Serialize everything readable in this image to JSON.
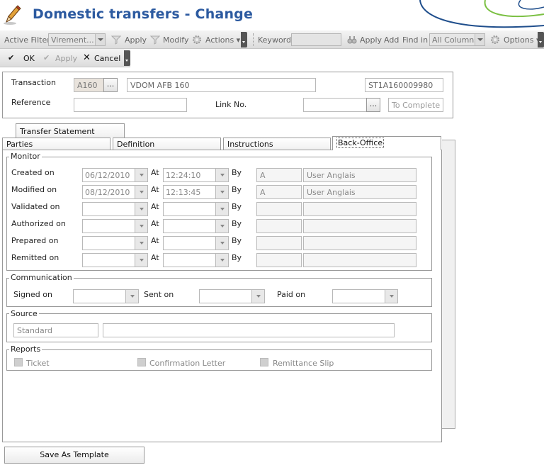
{
  "window": {
    "title": "Domestic transfers - Change"
  },
  "toolbar": {
    "active_filter_label": "Active Filter",
    "filter_value": "Virement...",
    "apply_label": "Apply",
    "modify_label": "Modify",
    "actions_label": "Actions",
    "keyword_label": "Keyword",
    "keyword_value": "",
    "apply2_label": "Apply",
    "add_label": "Add",
    "find_in_label": "Find in",
    "find_in_value": "All Columns",
    "options_label": "Options"
  },
  "toolbar2": {
    "ok_label": "OK",
    "apply_label": "Apply",
    "cancel_label": "Cancel"
  },
  "header": {
    "transaction_label": "Transaction",
    "transaction_code": "A160",
    "transaction_name": "VDOM AFB 160",
    "transaction_ref": "ST1A160009980",
    "reference_label": "Reference",
    "reference_value": "",
    "link_no_label": "Link No.",
    "link_no_value": "",
    "status_value": "To Complete",
    "browse_label": "..."
  },
  "tabs": {
    "transfer_statement": "Transfer Statement",
    "parties": "Parties",
    "definition": "Definition",
    "instructions": "Instructions",
    "back_office": "Back-Office"
  },
  "monitor": {
    "title": "Monitor",
    "at_label": "At",
    "by_label": "By",
    "rows": [
      {
        "label": "Created on",
        "date": "06/12/2010",
        "time": "12:24:10",
        "by_code": "A",
        "by_name": "User Anglais"
      },
      {
        "label": "Modified on",
        "date": "08/12/2010",
        "time": "12:13:45",
        "by_code": "A",
        "by_name": "User Anglais"
      },
      {
        "label": "Validated on",
        "date": "",
        "time": "",
        "by_code": "",
        "by_name": ""
      },
      {
        "label": "Authorized on",
        "date": "",
        "time": "",
        "by_code": "",
        "by_name": ""
      },
      {
        "label": "Prepared on",
        "date": "",
        "time": "",
        "by_code": "",
        "by_name": ""
      },
      {
        "label": "Remitted on",
        "date": "",
        "time": "",
        "by_code": "",
        "by_name": ""
      }
    ]
  },
  "communication": {
    "title": "Communication",
    "signed_on_label": "Signed on",
    "sent_on_label": "Sent on",
    "paid_on_label": "Paid on"
  },
  "source": {
    "title": "Source",
    "value": "Standard",
    "detail": ""
  },
  "reports": {
    "title": "Reports",
    "ticket": "Ticket",
    "confirmation_letter": "Confirmation Letter",
    "remittance_slip": "Remittance Slip"
  },
  "footer": {
    "save_template_label": "Save As Template"
  },
  "colors": {
    "title": "#2c5aa0",
    "swoosh_blue": "#1f4e8c",
    "swoosh_green": "#7bc043"
  }
}
